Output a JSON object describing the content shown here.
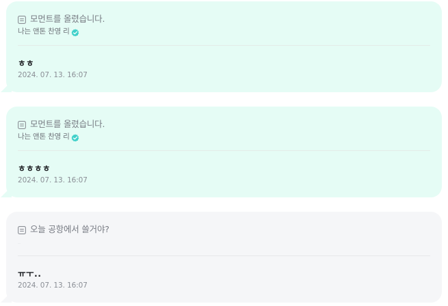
{
  "colors": {
    "mint_bubble": "#e5fcf5",
    "gray_bubble": "#f5f6f8",
    "verified_badge": "#3fd0c9"
  },
  "posts": [
    {
      "variant": "mint",
      "icon": "document-icon",
      "header": "모먼트를 올렸습니다.",
      "author": "나는 앤톤 찬영 리",
      "verified": true,
      "body": "ㅎㅎ",
      "timestamp": "2024. 07. 13. 16:07"
    },
    {
      "variant": "mint",
      "icon": "document-icon",
      "header": "모먼트를 올렸습니다.",
      "author": "나는 앤톤 찬영 리",
      "verified": true,
      "body": "ㅎㅎㅎㅎ",
      "timestamp": "2024. 07. 13. 16:07"
    },
    {
      "variant": "gray",
      "icon": "document-icon",
      "header": "오늘 공항에서 쓸거야?",
      "author": "",
      "verified": false,
      "body": "ㅠㅜ..",
      "timestamp": "2024. 07. 13. 16:07"
    }
  ]
}
